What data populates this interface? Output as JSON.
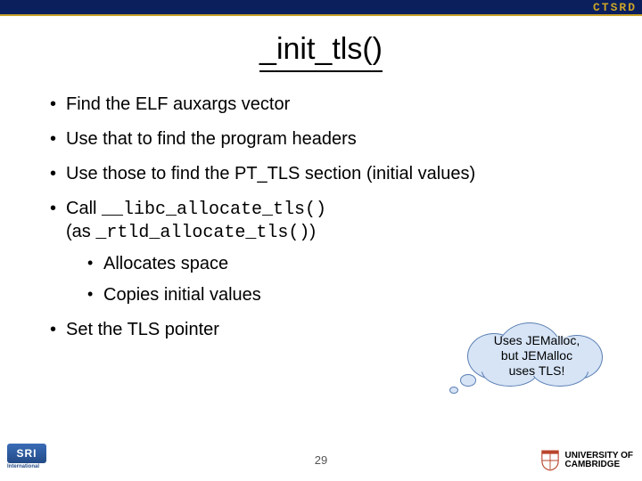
{
  "brand": "CTSRD",
  "title": "_init_tls()",
  "bullets": [
    "Find the ELF auxargs vector",
    "Use that to find the program headers",
    "Use those to find the PT_TLS section (initial values)"
  ],
  "call_prefix": "Call ",
  "call_fn": "__libc_allocate_tls()",
  "call_as_prefix": "(as ",
  "call_as_fn": "_rtld_allocate_tls()",
  "call_as_suffix": ")",
  "sub_bullets": [
    "Allocates space",
    "Copies initial values"
  ],
  "last_bullet": "Set the TLS pointer",
  "cloud_line1": "Uses JEMalloc,",
  "cloud_line2": "but JEMalloc",
  "cloud_line3": "uses TLS!",
  "page_number": "29",
  "sri_label": "SRI",
  "sri_sub": "International",
  "cam_line1": "UNIVERSITY OF",
  "cam_line2": "CAMBRIDGE"
}
